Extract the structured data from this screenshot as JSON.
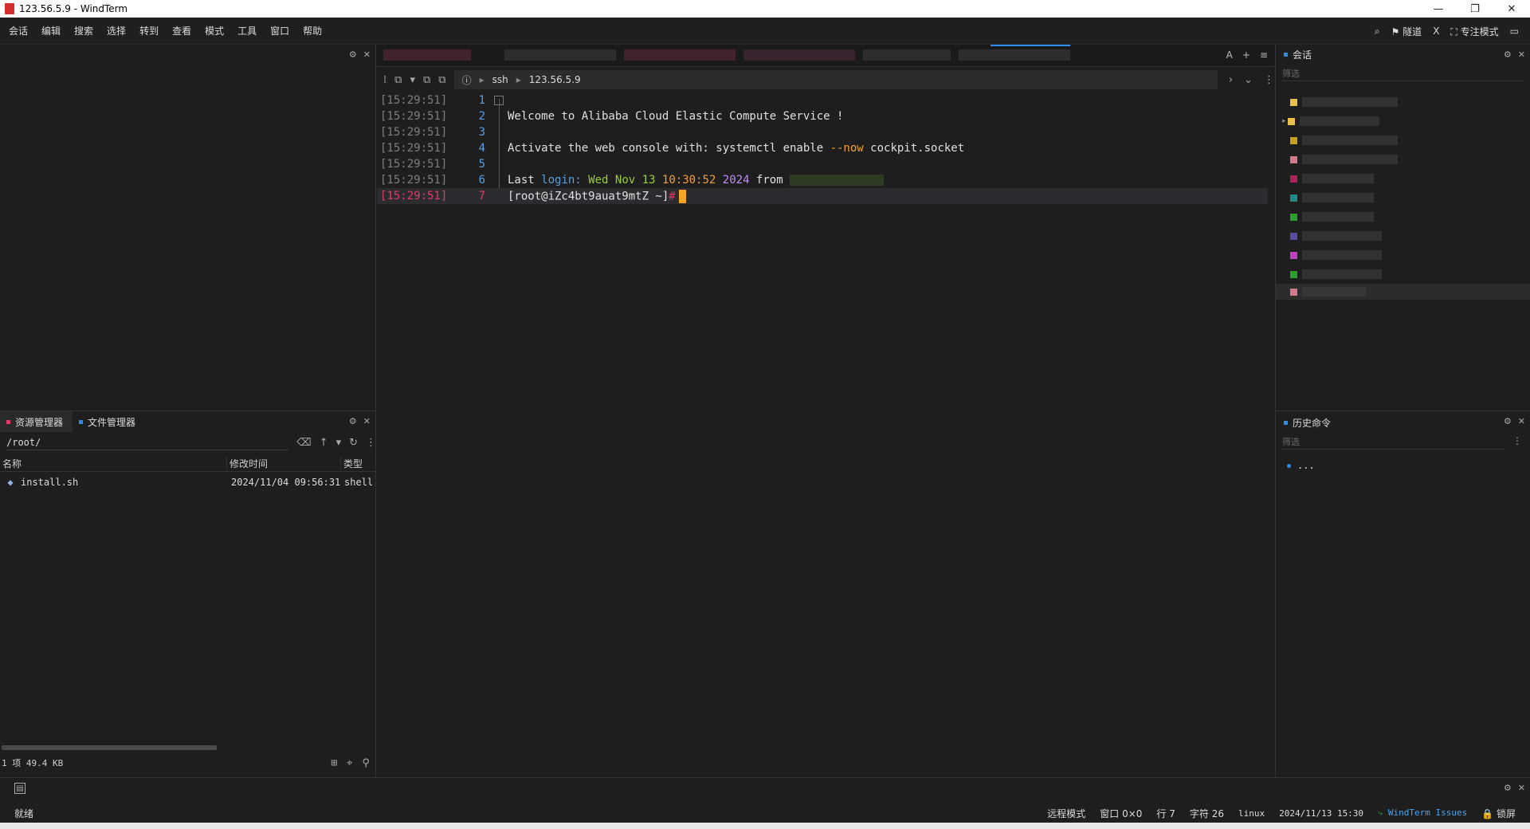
{
  "window": {
    "title": "123.56.5.9 - WindTerm",
    "controls": [
      "—",
      "❐",
      "✕"
    ]
  },
  "menu": {
    "items": [
      "会话",
      "编辑",
      "搜索",
      "选择",
      "转到",
      "查看",
      "模式",
      "工具",
      "窗口",
      "帮助"
    ],
    "right_tools": {
      "search": "⌕",
      "tunnel": "隧道",
      "x": "X",
      "focus_mode": "专注模式",
      "layout": "▭"
    }
  },
  "left_panel": {
    "tabs": [
      "资源管理器",
      "文件管理器"
    ],
    "path": "/root/",
    "columns": {
      "name": "名称",
      "modified": "修改时间",
      "type": "类型"
    },
    "files": [
      {
        "name": "install.sh",
        "modified": "2024/11/04 09:56:31",
        "type": "shell"
      }
    ],
    "footer": "1 项 49.4 KB"
  },
  "terminal": {
    "breadcrumb": {
      "protocol": "ssh",
      "host": "123.56.5.9"
    },
    "lines": [
      {
        "ts": "[15:29:51]",
        "n": "1",
        "text": ""
      },
      {
        "ts": "[15:29:51]",
        "n": "2",
        "text": "Welcome to Alibaba Cloud Elastic Compute Service !"
      },
      {
        "ts": "[15:29:51]",
        "n": "3",
        "text": ""
      },
      {
        "ts": "[15:29:51]",
        "n": "4",
        "pre": "Activate the web console with: systemctl enable ",
        "flag": "--now",
        "post": " cockpit.socket"
      },
      {
        "ts": "[15:29:51]",
        "n": "5",
        "text": ""
      },
      {
        "ts": "[15:29:51]",
        "n": "6",
        "pre": "Last ",
        "kw": "login:",
        "date": "Wed Nov 13",
        "time": "10:30:52",
        "year": "2024",
        "post": " from"
      },
      {
        "ts": "[15:29:51]",
        "n": "7",
        "prompt": "[root@iZc4bt9auat9mtZ ~]",
        "hash": "#"
      }
    ]
  },
  "sessions_panel": {
    "title": "会话",
    "filter_placeholder": "筛选",
    "items_colors": [
      "#e8c04a",
      "#e8c04a",
      "#c8a020",
      "#d07a8a",
      "#b0205a",
      "#1e8a8a",
      "#2aa02a",
      "#5a4aa0",
      "#c040c0",
      "#2aa02a",
      "#d07a8a"
    ]
  },
  "history_panel": {
    "title": "历史命令",
    "filter_placeholder": "筛选",
    "items": [
      "..."
    ]
  },
  "status": {
    "ready": "就绪",
    "mode": "远程模式",
    "window": "窗口 0×0",
    "line": "行 7",
    "char": "字符 26",
    "os": "linux",
    "datetime": "2024/11/13 15:30",
    "issues": "WindTerm Issues",
    "lock": "锁屏"
  },
  "colors": {
    "accent": "#2c8cf0",
    "cursor": "#f5a623",
    "prompt_highlight": "#e03c6a"
  }
}
